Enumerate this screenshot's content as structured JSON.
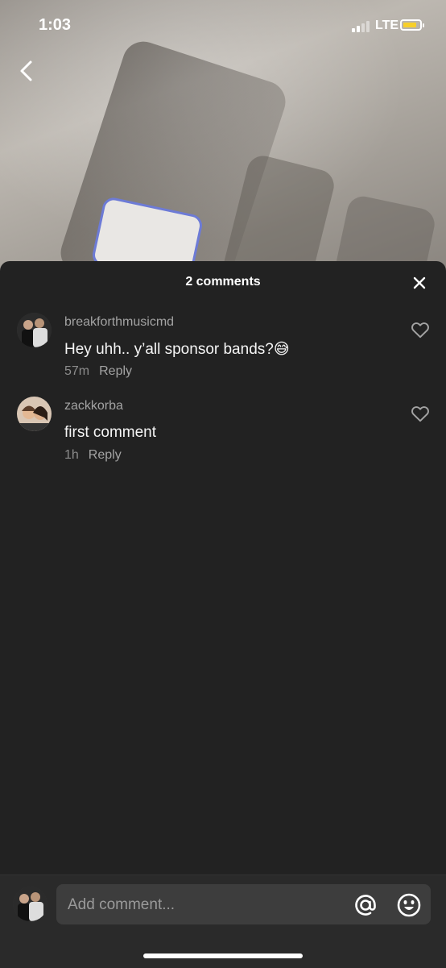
{
  "status_bar": {
    "time": "1:03",
    "network": "LTE"
  },
  "comments_panel": {
    "title": "2 comments",
    "comments": [
      {
        "username": "breakforthmusicmd",
        "text": "Hey uhh.. y’all sponsor bands?",
        "emoji": "😅",
        "time_ago": "57m",
        "reply_label": "Reply"
      },
      {
        "username": "zackkorba",
        "text": "first comment",
        "time_ago": "1h",
        "reply_label": "Reply"
      }
    ]
  },
  "input": {
    "placeholder": "Add comment..."
  },
  "icons": {
    "back": "chevron-left-icon",
    "close": "close-icon",
    "like": "heart-icon",
    "mention": "at-sign-icon",
    "emoji": "emoji-icon"
  },
  "colors": {
    "sheet_bg": "#222222",
    "battery": "#f7cf2a"
  }
}
